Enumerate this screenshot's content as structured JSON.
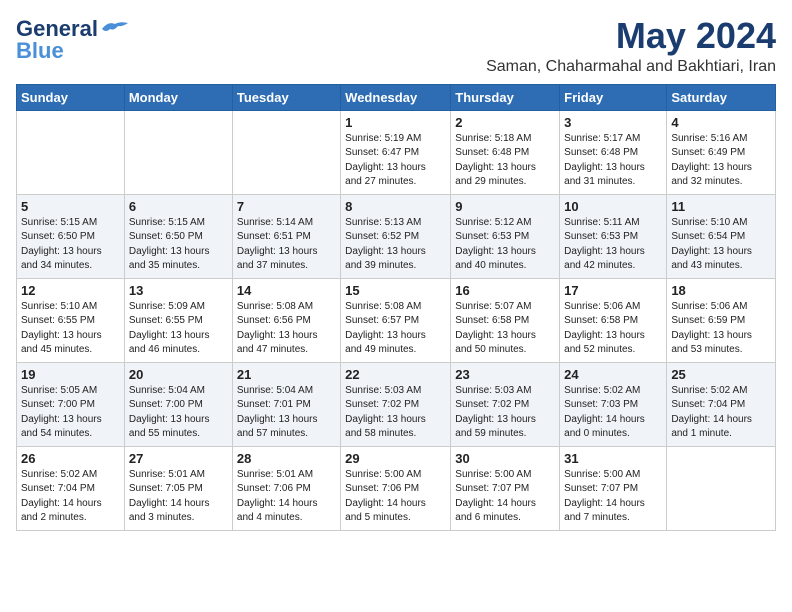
{
  "header": {
    "logo_general": "General",
    "logo_blue": "Blue",
    "month_title": "May 2024",
    "location": "Saman, Chaharmahal and Bakhtiari, Iran"
  },
  "days_of_week": [
    "Sunday",
    "Monday",
    "Tuesday",
    "Wednesday",
    "Thursday",
    "Friday",
    "Saturday"
  ],
  "weeks": [
    [
      {
        "day": "",
        "content": ""
      },
      {
        "day": "",
        "content": ""
      },
      {
        "day": "",
        "content": ""
      },
      {
        "day": "1",
        "content": "Sunrise: 5:19 AM\nSunset: 6:47 PM\nDaylight: 13 hours\nand 27 minutes."
      },
      {
        "day": "2",
        "content": "Sunrise: 5:18 AM\nSunset: 6:48 PM\nDaylight: 13 hours\nand 29 minutes."
      },
      {
        "day": "3",
        "content": "Sunrise: 5:17 AM\nSunset: 6:48 PM\nDaylight: 13 hours\nand 31 minutes."
      },
      {
        "day": "4",
        "content": "Sunrise: 5:16 AM\nSunset: 6:49 PM\nDaylight: 13 hours\nand 32 minutes."
      }
    ],
    [
      {
        "day": "5",
        "content": "Sunrise: 5:15 AM\nSunset: 6:50 PM\nDaylight: 13 hours\nand 34 minutes."
      },
      {
        "day": "6",
        "content": "Sunrise: 5:15 AM\nSunset: 6:50 PM\nDaylight: 13 hours\nand 35 minutes."
      },
      {
        "day": "7",
        "content": "Sunrise: 5:14 AM\nSunset: 6:51 PM\nDaylight: 13 hours\nand 37 minutes."
      },
      {
        "day": "8",
        "content": "Sunrise: 5:13 AM\nSunset: 6:52 PM\nDaylight: 13 hours\nand 39 minutes."
      },
      {
        "day": "9",
        "content": "Sunrise: 5:12 AM\nSunset: 6:53 PM\nDaylight: 13 hours\nand 40 minutes."
      },
      {
        "day": "10",
        "content": "Sunrise: 5:11 AM\nSunset: 6:53 PM\nDaylight: 13 hours\nand 42 minutes."
      },
      {
        "day": "11",
        "content": "Sunrise: 5:10 AM\nSunset: 6:54 PM\nDaylight: 13 hours\nand 43 minutes."
      }
    ],
    [
      {
        "day": "12",
        "content": "Sunrise: 5:10 AM\nSunset: 6:55 PM\nDaylight: 13 hours\nand 45 minutes."
      },
      {
        "day": "13",
        "content": "Sunrise: 5:09 AM\nSunset: 6:55 PM\nDaylight: 13 hours\nand 46 minutes."
      },
      {
        "day": "14",
        "content": "Sunrise: 5:08 AM\nSunset: 6:56 PM\nDaylight: 13 hours\nand 47 minutes."
      },
      {
        "day": "15",
        "content": "Sunrise: 5:08 AM\nSunset: 6:57 PM\nDaylight: 13 hours\nand 49 minutes."
      },
      {
        "day": "16",
        "content": "Sunrise: 5:07 AM\nSunset: 6:58 PM\nDaylight: 13 hours\nand 50 minutes."
      },
      {
        "day": "17",
        "content": "Sunrise: 5:06 AM\nSunset: 6:58 PM\nDaylight: 13 hours\nand 52 minutes."
      },
      {
        "day": "18",
        "content": "Sunrise: 5:06 AM\nSunset: 6:59 PM\nDaylight: 13 hours\nand 53 minutes."
      }
    ],
    [
      {
        "day": "19",
        "content": "Sunrise: 5:05 AM\nSunset: 7:00 PM\nDaylight: 13 hours\nand 54 minutes."
      },
      {
        "day": "20",
        "content": "Sunrise: 5:04 AM\nSunset: 7:00 PM\nDaylight: 13 hours\nand 55 minutes."
      },
      {
        "day": "21",
        "content": "Sunrise: 5:04 AM\nSunset: 7:01 PM\nDaylight: 13 hours\nand 57 minutes."
      },
      {
        "day": "22",
        "content": "Sunrise: 5:03 AM\nSunset: 7:02 PM\nDaylight: 13 hours\nand 58 minutes."
      },
      {
        "day": "23",
        "content": "Sunrise: 5:03 AM\nSunset: 7:02 PM\nDaylight: 13 hours\nand 59 minutes."
      },
      {
        "day": "24",
        "content": "Sunrise: 5:02 AM\nSunset: 7:03 PM\nDaylight: 14 hours\nand 0 minutes."
      },
      {
        "day": "25",
        "content": "Sunrise: 5:02 AM\nSunset: 7:04 PM\nDaylight: 14 hours\nand 1 minute."
      }
    ],
    [
      {
        "day": "26",
        "content": "Sunrise: 5:02 AM\nSunset: 7:04 PM\nDaylight: 14 hours\nand 2 minutes."
      },
      {
        "day": "27",
        "content": "Sunrise: 5:01 AM\nSunset: 7:05 PM\nDaylight: 14 hours\nand 3 minutes."
      },
      {
        "day": "28",
        "content": "Sunrise: 5:01 AM\nSunset: 7:06 PM\nDaylight: 14 hours\nand 4 minutes."
      },
      {
        "day": "29",
        "content": "Sunrise: 5:00 AM\nSunset: 7:06 PM\nDaylight: 14 hours\nand 5 minutes."
      },
      {
        "day": "30",
        "content": "Sunrise: 5:00 AM\nSunset: 7:07 PM\nDaylight: 14 hours\nand 6 minutes."
      },
      {
        "day": "31",
        "content": "Sunrise: 5:00 AM\nSunset: 7:07 PM\nDaylight: 14 hours\nand 7 minutes."
      },
      {
        "day": "",
        "content": ""
      }
    ]
  ]
}
